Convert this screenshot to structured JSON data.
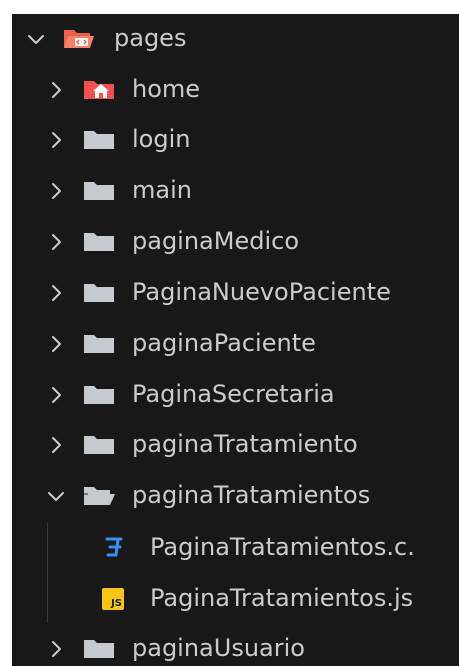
{
  "explorer": {
    "root": {
      "label": "pages",
      "expanded": true,
      "icon": "folder-open-red-icon"
    },
    "items": [
      {
        "label": "home",
        "type": "folder",
        "expanded": false,
        "icon": "folder-home-icon"
      },
      {
        "label": "login",
        "type": "folder",
        "expanded": false,
        "icon": "folder-icon"
      },
      {
        "label": "main",
        "type": "folder",
        "expanded": false,
        "icon": "folder-icon"
      },
      {
        "label": "paginaMedico",
        "type": "folder",
        "expanded": false,
        "icon": "folder-icon"
      },
      {
        "label": "PaginaNuevoPaciente",
        "type": "folder",
        "expanded": false,
        "icon": "folder-icon"
      },
      {
        "label": "paginaPaciente",
        "type": "folder",
        "expanded": false,
        "icon": "folder-icon"
      },
      {
        "label": "PaginaSecretaria",
        "type": "folder",
        "expanded": false,
        "icon": "folder-icon"
      },
      {
        "label": "paginaTratamiento",
        "type": "folder",
        "expanded": false,
        "icon": "folder-icon"
      },
      {
        "label": "paginaTratamientos",
        "type": "folder",
        "expanded": true,
        "icon": "folder-open-icon"
      },
      {
        "label": "PaginaTratamientos.c.",
        "type": "file",
        "icon": "css-file-icon"
      },
      {
        "label": "PaginaTratamientos.js",
        "type": "file",
        "icon": "js-file-icon",
        "badge": "JS"
      },
      {
        "label": "paginaUsuario",
        "type": "folder",
        "expanded": false,
        "icon": "folder-icon"
      }
    ]
  },
  "colors": {
    "background": "#181818",
    "text": "#cccccc",
    "folder": "#c5c9d0",
    "root_folder": "#e8624a",
    "home_folder": "#f0504f",
    "css": "#3a8ef6",
    "js_badge": "#f5c518"
  }
}
